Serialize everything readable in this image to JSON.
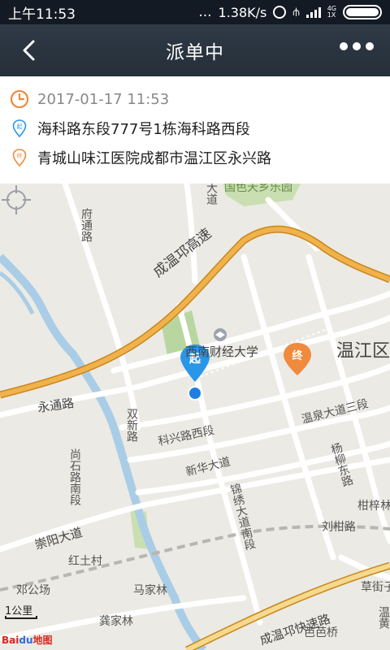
{
  "status_bar": {
    "time": "上午11:53",
    "dots": "...",
    "speed": "1.38K/s",
    "net_top": "4G",
    "net_bottom": "1X"
  },
  "title_bar": {
    "title": "派单中"
  },
  "order": {
    "datetime": "2017-01-17 11:53",
    "start_address": "海科路东段777号1栋海科路西段",
    "end_address": "青城山味江医院成都市温江区永兴路",
    "start_badge": "起",
    "end_badge": "终"
  },
  "colors": {
    "orange": "#f08a3c",
    "blue": "#2a96e8",
    "highway": "#f0b24a",
    "highway_edge": "#c8861e"
  },
  "map": {
    "labels": {
      "fu_tong_lu": "府通路",
      "da_dao": "大道",
      "park": "国色天乡乐园",
      "cheng_wen_qiong_gao_su": "成温邛高速",
      "xi_nan_cai_jing": "西南财经大学",
      "wen_jiang_qu": "温江区",
      "yong_tong_lu": "永通路",
      "shuang_xin_lu": "双新路",
      "ke_xing_lu_xi_duan": "科兴路西段",
      "wen_quan_da_dao_san_duan": "温泉大道三段",
      "yang_liu_dong_lu": "杨柳东路",
      "xin_hua_da_dao": "新华大道",
      "shang_shi_lu_nan_duan": "尚石路南段",
      "jin_xiu_da_dao_nan_duan": "锦绣大道南段",
      "gan_zi_lin": "柑梓林",
      "liu_gan_lu": "刘柑路",
      "chong_yang_da_dao": "崇阳大道",
      "hong_tu_cun": "红土村",
      "deng_gong_chang": "邓公场",
      "ma_jia_lin": "马家林",
      "cao_jie_zi": "草街子",
      "gong_jia_lin": "龚家林",
      "cheng_wen_qiong_kuai_su_lu": "成温邛快速路",
      "ba_ba_qiao": "芭芭桥",
      "wen_huang": "温黄"
    },
    "scale": "1公里",
    "logo_bai": "Bai",
    "logo_du": "du",
    "logo_map": "地图"
  }
}
